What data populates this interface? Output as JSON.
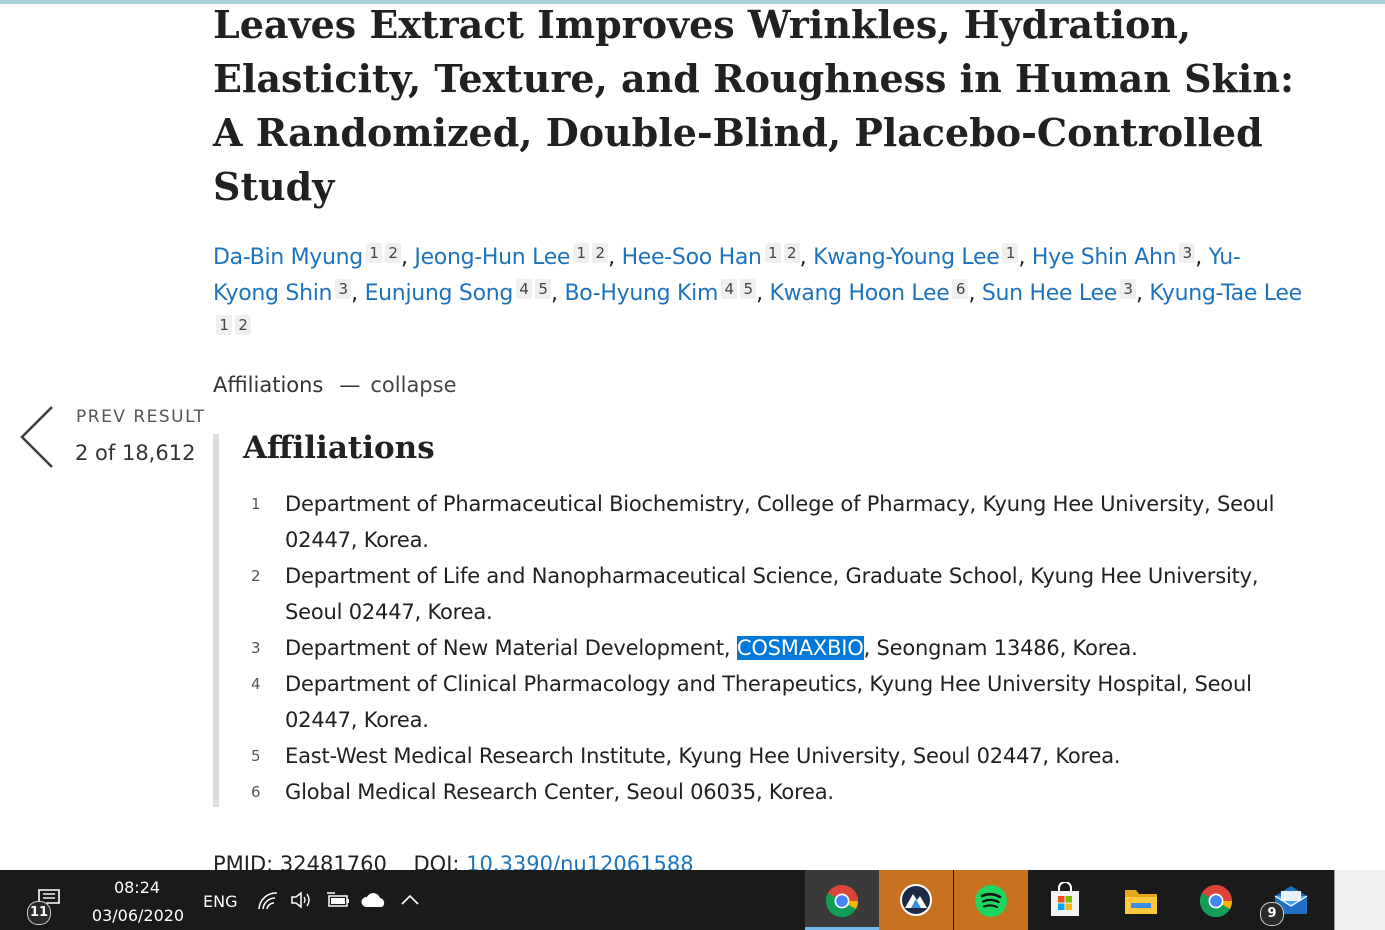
{
  "article": {
    "title": "Leaves Extract Improves Wrinkles, Hydration, Elasticity, Texture, and Roughness in Human Skin: A Randomized, Double-Blind, Placebo-Controlled Study",
    "authors": [
      {
        "name": "Da-Bin Myung",
        "affs": [
          "1",
          "2"
        ]
      },
      {
        "name": "Jeong-Hun Lee",
        "affs": [
          "1",
          "2"
        ]
      },
      {
        "name": "Hee-Soo Han",
        "affs": [
          "1",
          "2"
        ]
      },
      {
        "name": "Kwang-Young Lee",
        "affs": [
          "1"
        ]
      },
      {
        "name": "Hye Shin Ahn",
        "affs": [
          "3"
        ]
      },
      {
        "name": "Yu-Kyong Shin",
        "affs": [
          "3"
        ]
      },
      {
        "name": "Eunjung Song",
        "affs": [
          "4",
          "5"
        ]
      },
      {
        "name": "Bo-Hyung Kim",
        "affs": [
          "4",
          "5"
        ]
      },
      {
        "name": "Kwang Hoon Lee",
        "affs": [
          "6"
        ]
      },
      {
        "name": "Sun Hee Lee",
        "affs": [
          "3"
        ]
      },
      {
        "name": "Kyung-Tae Lee",
        "affs": [
          "1",
          "2"
        ]
      }
    ],
    "affiliations_toggle": {
      "label": "Affiliations",
      "dash": "—",
      "action": "collapse"
    },
    "affiliations_heading": "Affiliations",
    "affiliations": [
      {
        "num": "1",
        "text": "Department of Pharmaceutical Biochemistry, College of Pharmacy, Kyung Hee University, Seoul 02447, Korea."
      },
      {
        "num": "2",
        "text": "Department of Life and Nanopharmaceutical Science, Graduate School, Kyung Hee University, Seoul 02447, Korea."
      },
      {
        "num": "3",
        "text_before": "Department of New Material Development, ",
        "highlight": "COSMAXBIO",
        "text_after": ", Seongnam 13486, Korea."
      },
      {
        "num": "4",
        "text": "Department of Clinical Pharmacology and Therapeutics, Kyung Hee University Hospital, Seoul 02447, Korea."
      },
      {
        "num": "5",
        "text": "East-West Medical Research Institute, Kyung Hee University, Seoul 02447, Korea."
      },
      {
        "num": "6",
        "text": "Global Medical Research Center, Seoul 06035, Korea."
      }
    ],
    "pmid_label": "PMID:",
    "pmid": "32481760",
    "doi_label": "DOI:",
    "doi": "10.3390/nu12061588"
  },
  "nav": {
    "prev_label": "PREV RESULT",
    "result_position": "2 of 18,612",
    "icon": "chevron-left-icon"
  },
  "taskbar": {
    "notifications_count": "11",
    "time": "08:24",
    "date": "03/06/2020",
    "language": "ENG",
    "mail_badge": "9",
    "tray_icons": [
      "wifi-icon",
      "volume-icon",
      "battery-icon",
      "onedrive-icon",
      "chevron-up-icon"
    ],
    "apps": [
      "chrome-icon",
      "vpn-icon",
      "spotify-icon",
      "store-icon",
      "file-explorer-icon",
      "chrome-icon",
      "mail-icon"
    ],
    "colors": {
      "running_app_bg": "#c8721f",
      "accent": "#76b9ed",
      "link": "#1e73be",
      "selection": "#0078d7"
    }
  }
}
